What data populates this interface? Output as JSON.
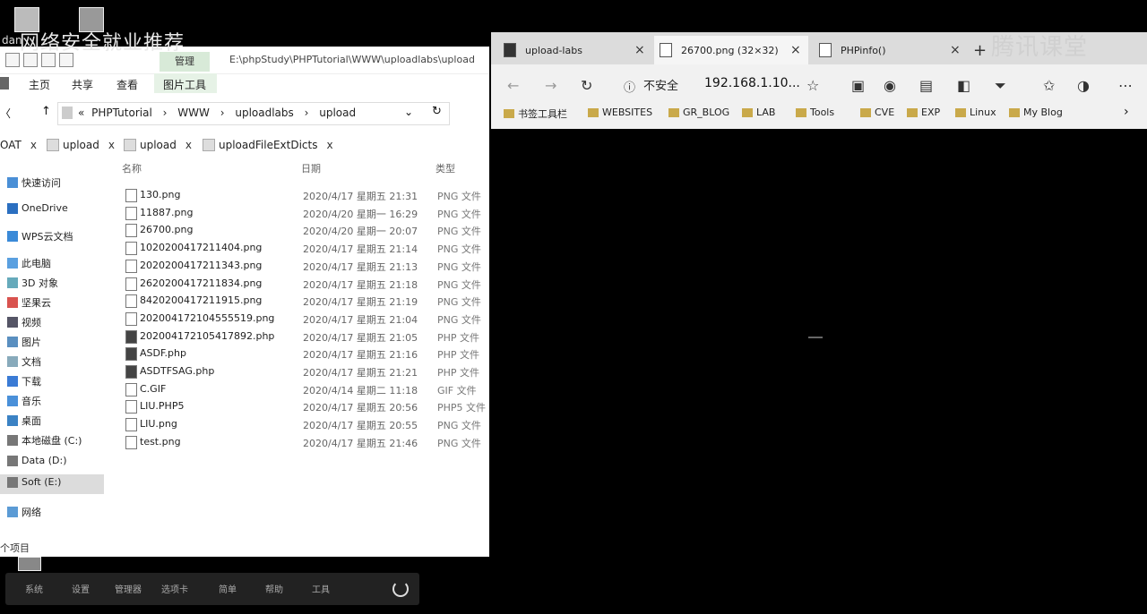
{
  "overlay": {
    "watermark_left": "网络安全就业推荐",
    "watermark_right": "腾讯课堂",
    "desktop_user": "dan"
  },
  "explorer": {
    "title_path": "E:\\phpStudy\\PHPTutorial\\WWW\\uploadlabs\\upload",
    "manage_label": "管理",
    "ribbon_tabs": [
      "主页",
      "共享",
      "查看",
      "图片工具"
    ],
    "breadcrumb": [
      "«",
      "PHPTutorial",
      "WWW",
      "uploadlabs",
      "upload"
    ],
    "folder_tabs": [
      {
        "label": "OAT"
      },
      {
        "label": "upload"
      },
      {
        "label": "upload"
      },
      {
        "label": "uploadFileExtDicts"
      }
    ],
    "columns": {
      "name": "名称",
      "date": "日期",
      "type": "类型"
    },
    "nav_items": [
      "快速访问",
      "OneDrive",
      "WPS云文档",
      "此电脑",
      "3D 对象",
      "坚果云",
      "视频",
      "图片",
      "文档",
      "下载",
      "音乐",
      "桌面",
      "本地磁盘 (C:)",
      "Data (D:)",
      "Soft (E:)",
      "网络"
    ],
    "files": [
      {
        "name": "130.png",
        "date": "2020/4/17 星期五 21:31",
        "type": "PNG 文件",
        "kind": "img"
      },
      {
        "name": "11887.png",
        "date": "2020/4/20 星期一 16:29",
        "type": "PNG 文件",
        "kind": "img"
      },
      {
        "name": "26700.png",
        "date": "2020/4/20 星期一 20:07",
        "type": "PNG 文件",
        "kind": "img"
      },
      {
        "name": "1020200417211404.png",
        "date": "2020/4/17 星期五 21:14",
        "type": "PNG 文件",
        "kind": "img"
      },
      {
        "name": "2020200417211343.png",
        "date": "2020/4/17 星期五 21:13",
        "type": "PNG 文件",
        "kind": "img"
      },
      {
        "name": "2620200417211834.png",
        "date": "2020/4/17 星期五 21:18",
        "type": "PNG 文件",
        "kind": "img"
      },
      {
        "name": "8420200417211915.png",
        "date": "2020/4/17 星期五 21:19",
        "type": "PNG 文件",
        "kind": "img"
      },
      {
        "name": "202004172104555519.png",
        "date": "2020/4/17 星期五 21:04",
        "type": "PNG 文件",
        "kind": "img"
      },
      {
        "name": "202004172105417892.php",
        "date": "2020/4/17 星期五 21:05",
        "type": "PHP 文件",
        "kind": "php"
      },
      {
        "name": "ASDF.php",
        "date": "2020/4/17 星期五 21:16",
        "type": "PHP 文件",
        "kind": "php"
      },
      {
        "name": "ASDTFSAG.php",
        "date": "2020/4/17 星期五 21:21",
        "type": "PHP 文件",
        "kind": "php"
      },
      {
        "name": "C.GIF",
        "date": "2020/4/14 星期二 11:18",
        "type": "GIF 文件",
        "kind": "img"
      },
      {
        "name": "LIU.PHP5",
        "date": "2020/4/17 星期五 20:56",
        "type": "PHP5 文件",
        "kind": "img"
      },
      {
        "name": "LIU.png",
        "date": "2020/4/17 星期五 20:55",
        "type": "PNG 文件",
        "kind": "img"
      },
      {
        "name": "test.png",
        "date": "2020/4/17 星期五 21:46",
        "type": "PNG 文件",
        "kind": "img"
      }
    ],
    "status": "个项目"
  },
  "taskbar": {
    "items": [
      "系统",
      "设置",
      "管理器",
      "选项卡",
      "简单",
      "帮助",
      "工具"
    ]
  },
  "browser": {
    "tabs": [
      {
        "label": "upload-labs"
      },
      {
        "label": "26700.png (32×32)"
      },
      {
        "label": "PHPinfo()"
      }
    ],
    "new_tab": "+",
    "insecure_label": "不安全",
    "url": "192.168.1.10...",
    "bookmarks": [
      "书签工具栏",
      "WEBSITES",
      "GR_BLOG",
      "LAB",
      "Tools",
      "CVE",
      "EXP",
      "Linux",
      "My Blog"
    ]
  }
}
